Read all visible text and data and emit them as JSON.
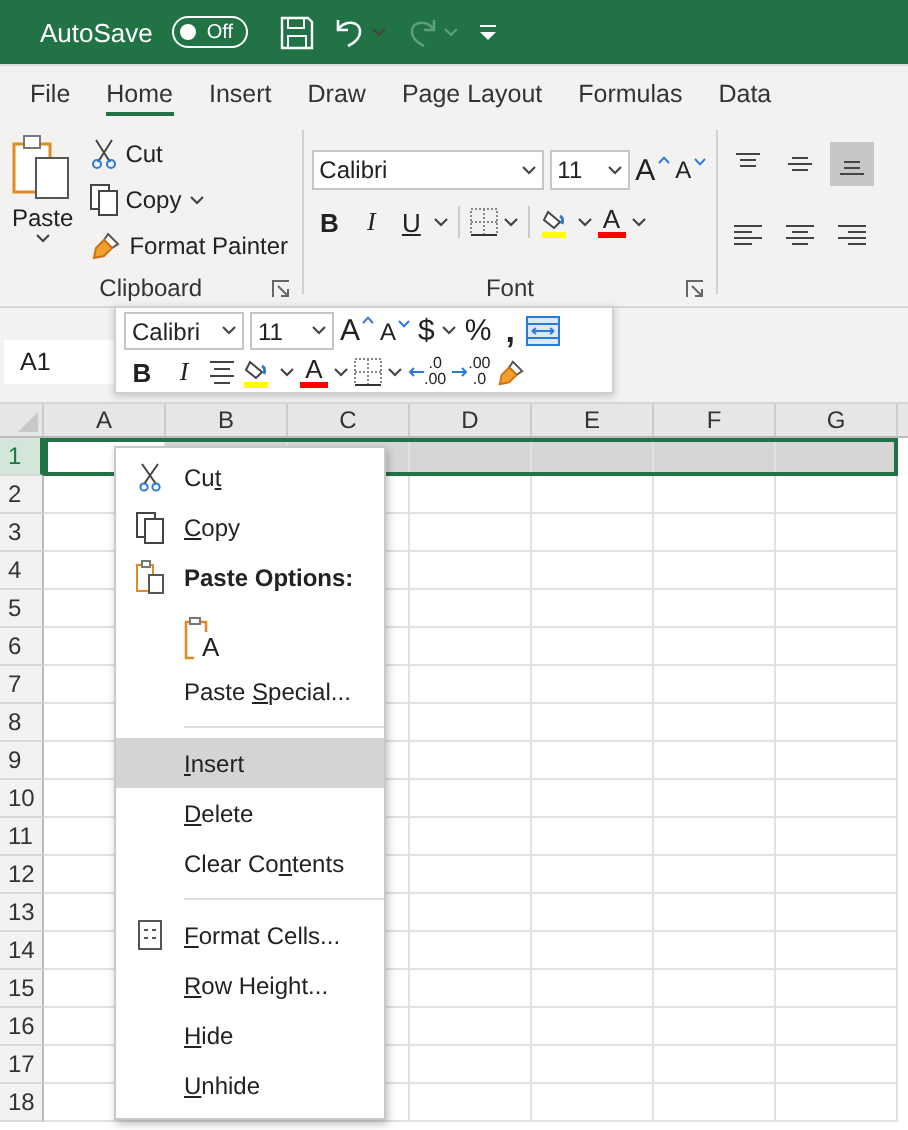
{
  "title_bar": {
    "autosave_label": "AutoSave",
    "autosave_toggle": {
      "on": false,
      "label": "Off"
    },
    "redo": {
      "disabled": true
    }
  },
  "ribbon_tabs": [
    {
      "label": "File",
      "selected": false
    },
    {
      "label": "Home",
      "selected": true
    },
    {
      "label": "Insert",
      "selected": false
    },
    {
      "label": "Draw",
      "selected": false
    },
    {
      "label": "Page Layout",
      "selected": false
    },
    {
      "label": "Formulas",
      "selected": false
    },
    {
      "label": "Data",
      "selected": false
    }
  ],
  "clipboard_group": {
    "paste": "Paste",
    "cut": "Cut",
    "copy": "Copy",
    "format_painter": "Format Painter",
    "label": "Clipboard"
  },
  "font_group": {
    "font": "Calibri",
    "size": "11",
    "grow_glyph": "A",
    "shrink_glyph": "A",
    "bold": "B",
    "italic": "I",
    "underline": "U",
    "font_color_glyph": "A",
    "label": "Font"
  },
  "alignment_group": {
    "buttons": [
      {
        "kind": "top",
        "selected": false
      },
      {
        "kind": "middle",
        "selected": false
      },
      {
        "kind": "bottom",
        "selected": true
      },
      {
        "kind": "left",
        "selected": false
      },
      {
        "kind": "center",
        "selected": false
      },
      {
        "kind": "right",
        "selected": false
      }
    ]
  },
  "name_box": {
    "value": "A1"
  },
  "mini_toolbar": {
    "font": "Calibri",
    "size": "11",
    "grow_glyph": "A",
    "shrink_glyph": "A",
    "currency": "$",
    "percent": "%",
    "comma": ",",
    "bold": "B",
    "italic": "I",
    "font_color_glyph": "A",
    "increase_decimal": [
      ".0",
      ".00"
    ],
    "decrease_decimal": [
      ".00",
      ".0"
    ]
  },
  "columns": [
    "A",
    "B",
    "C",
    "D",
    "E",
    "F",
    "G"
  ],
  "rows": [
    {
      "label": "1",
      "selected": true
    },
    {
      "label": "2",
      "selected": false
    },
    {
      "label": "3",
      "selected": false
    },
    {
      "label": "4",
      "selected": false
    },
    {
      "label": "5",
      "selected": false
    },
    {
      "label": "6",
      "selected": false
    },
    {
      "label": "7",
      "selected": false
    },
    {
      "label": "8",
      "selected": false
    },
    {
      "label": "9",
      "selected": false
    },
    {
      "label": "10",
      "selected": false
    },
    {
      "label": "11",
      "selected": false
    },
    {
      "label": "12",
      "selected": false
    },
    {
      "label": "13",
      "selected": false
    },
    {
      "label": "14",
      "selected": false
    },
    {
      "label": "15",
      "selected": false
    },
    {
      "label": "16",
      "selected": false
    },
    {
      "label": "17",
      "selected": false
    },
    {
      "label": "18",
      "selected": false
    }
  ],
  "context_menu": [
    {
      "kind": "cut",
      "pre": "Cu",
      "key": "t",
      "selected": false
    },
    {
      "kind": "copy",
      "key": "C",
      "post": "opy",
      "selected": false
    },
    {
      "kind": "heading",
      "label": "Paste Options:"
    },
    {
      "kind": "paste_option",
      "glyph": "A"
    },
    {
      "kind": "item",
      "pre": "Paste ",
      "key": "S",
      "post": "pecial...",
      "selected": false
    },
    {
      "kind": "separator"
    },
    {
      "kind": "item",
      "key": "I",
      "post": "nsert",
      "selected": true
    },
    {
      "kind": "item",
      "key": "D",
      "post": "elete",
      "selected": false
    },
    {
      "kind": "item",
      "pre": "Clear Co",
      "key": "n",
      "post": "tents",
      "selected": false
    },
    {
      "kind": "separator"
    },
    {
      "kind": "format_cells",
      "key": "F",
      "post": "ormat Cells...",
      "selected": false
    },
    {
      "kind": "item",
      "key": "R",
      "post": "ow Height...",
      "selected": false
    },
    {
      "kind": "item",
      "key": "H",
      "post": "ide",
      "selected": false
    },
    {
      "kind": "item",
      "key": "U",
      "post": "nhide",
      "selected": false
    }
  ]
}
